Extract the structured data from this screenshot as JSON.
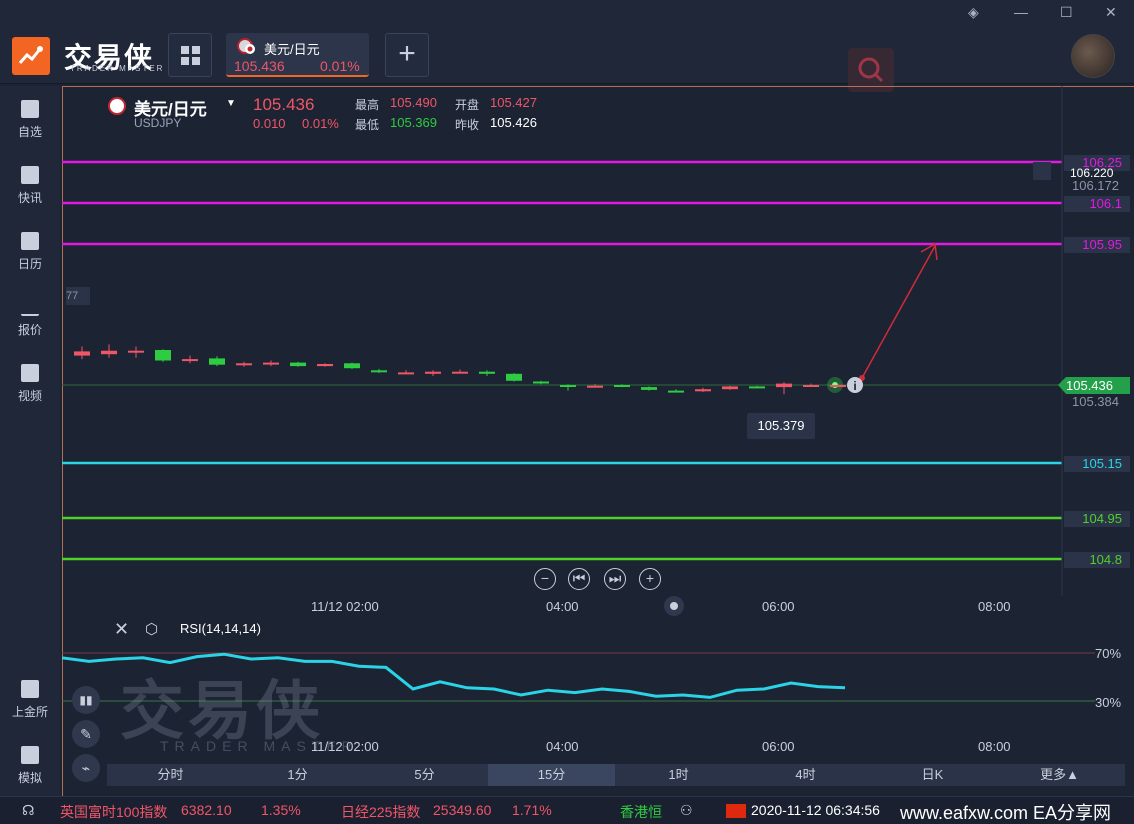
{
  "app": {
    "logo_title": "交易侠",
    "logo_subtitle": "TRADER MASTER"
  },
  "tabs": [
    {
      "name": "美元/日元",
      "price": "105.436",
      "change_pct": "0.01%"
    }
  ],
  "sidebar": {
    "items": [
      {
        "label": "自选",
        "icon": "bookmark-plus-icon"
      },
      {
        "label": "快讯",
        "icon": "news-icon"
      },
      {
        "label": "日历",
        "icon": "calendar-icon"
      },
      {
        "label": "报价",
        "icon": "quote-chart-icon"
      },
      {
        "label": "视频",
        "icon": "video-icon"
      },
      {
        "label": "上金所",
        "icon": "exchange-icon"
      },
      {
        "label": "模拟",
        "icon": "wallet-icon"
      }
    ]
  },
  "symbol": {
    "name": "美元/日元",
    "code": "USDJPY",
    "price": "105.436",
    "change": "0.010",
    "change_pct": "0.01%",
    "high_label": "最高",
    "high": "105.490",
    "open_label": "开盘",
    "open": "105.427",
    "low_label": "最低",
    "low": "105.369",
    "prev_close_label": "昨收",
    "prev_close": "105.426"
  },
  "levels": {
    "l1": "106.25",
    "l1_overlap": "106.220",
    "l1_sub": "106.172",
    "l2": "106.1",
    "l3": "105.95",
    "current": "105.436",
    "current_sub": "105.384",
    "s1": "105.15",
    "s2": "104.95",
    "s3": "104.8",
    "left_stub": "77"
  },
  "tooltip": "105.379",
  "time_axis": [
    "11/12 02:00",
    "04:00",
    "06:00",
    "08:00"
  ],
  "rsi": {
    "title": "RSI(14,14,14)",
    "upper": "70%",
    "lower": "30%"
  },
  "timeframes": [
    "分时",
    "1分",
    "5分",
    "15分",
    "1时",
    "4时",
    "日K",
    "更多▲"
  ],
  "active_timeframe": "15分",
  "ticker": {
    "i1_name": "英国富时100指数",
    "i1_value": "6382.10",
    "i1_pct": "1.35%",
    "i2_name": "日经225指数",
    "i2_value": "25349.60",
    "i2_pct": "1.71%",
    "i3_name": "香港恒",
    "datetime": "2020-11-12 06:34:56",
    "watermark": "www.eafxw.com EA分享网"
  },
  "colors": {
    "up": "#f05667",
    "down": "#2ecc40",
    "magenta": "#e418e4",
    "cyan": "#2ad4e6",
    "green_line": "#4fd12a",
    "accent": "#f26522"
  },
  "chart_data": {
    "type": "candlestick",
    "candles": [
      {
        "o": 105.399,
        "c": 105.405,
        "h": 105.412,
        "l": 105.394
      },
      {
        "o": 105.401,
        "c": 105.406,
        "h": 105.415,
        "l": 105.396
      },
      {
        "o": 105.405,
        "c": 105.406,
        "h": 105.412,
        "l": 105.396
      },
      {
        "o": 105.407,
        "c": 105.392,
        "h": 105.408,
        "l": 105.39
      },
      {
        "o": 105.392,
        "c": 105.394,
        "h": 105.399,
        "l": 105.388
      },
      {
        "o": 105.395,
        "c": 105.386,
        "h": 105.398,
        "l": 105.384
      },
      {
        "o": 105.386,
        "c": 105.388,
        "h": 105.39,
        "l": 105.383
      },
      {
        "o": 105.387,
        "c": 105.389,
        "h": 105.392,
        "l": 105.384
      },
      {
        "o": 105.389,
        "c": 105.384,
        "h": 105.39,
        "l": 105.383
      },
      {
        "o": 105.384,
        "c": 105.387,
        "h": 105.388,
        "l": 105.383
      },
      {
        "o": 105.388,
        "c": 105.381,
        "h": 105.389,
        "l": 105.38
      },
      {
        "o": 105.378,
        "c": 105.376,
        "h": 105.38,
        "l": 105.374
      },
      {
        "o": 105.375,
        "c": 105.375,
        "h": 105.378,
        "l": 105.373
      },
      {
        "o": 105.373,
        "c": 105.376,
        "h": 105.378,
        "l": 105.37
      },
      {
        "o": 105.376,
        "c": 105.376,
        "h": 105.379,
        "l": 105.374
      },
      {
        "o": 105.376,
        "c": 105.373,
        "h": 105.378,
        "l": 105.37
      },
      {
        "o": 105.373,
        "c": 105.363,
        "h": 105.374,
        "l": 105.362
      },
      {
        "o": 105.362,
        "c": 105.36,
        "h": 105.363,
        "l": 105.358
      },
      {
        "o": 105.357,
        "c": 105.356,
        "h": 105.358,
        "l": 105.349
      },
      {
        "o": 105.356,
        "c": 105.356,
        "h": 105.358,
        "l": 105.354
      },
      {
        "o": 105.357,
        "c": 105.355,
        "h": 105.358,
        "l": 105.354
      },
      {
        "o": 105.354,
        "c": 105.35,
        "h": 105.355,
        "l": 105.349
      },
      {
        "o": 105.349,
        "c": 105.348,
        "h": 105.351,
        "l": 105.347
      },
      {
        "o": 105.348,
        "c": 105.351,
        "h": 105.353,
        "l": 105.347
      },
      {
        "o": 105.351,
        "c": 105.355,
        "h": 105.356,
        "l": 105.35
      },
      {
        "o": 105.355,
        "c": 105.353,
        "h": 105.356,
        "l": 105.352
      },
      {
        "o": 105.354,
        "c": 105.359,
        "h": 105.361,
        "l": 105.344
      },
      {
        "o": 105.357,
        "c": 105.357,
        "h": 105.359,
        "l": 105.356
      },
      {
        "o": 105.357,
        "c": 105.357,
        "h": 105.358,
        "l": 105.356
      }
    ],
    "rsi": [
      66,
      63,
      65,
      66,
      62,
      67,
      69,
      65,
      66,
      63,
      63,
      59,
      58,
      40,
      46,
      41,
      40,
      35,
      39,
      37,
      40,
      38,
      34,
      35,
      33,
      39,
      40,
      45,
      42,
      41
    ]
  }
}
